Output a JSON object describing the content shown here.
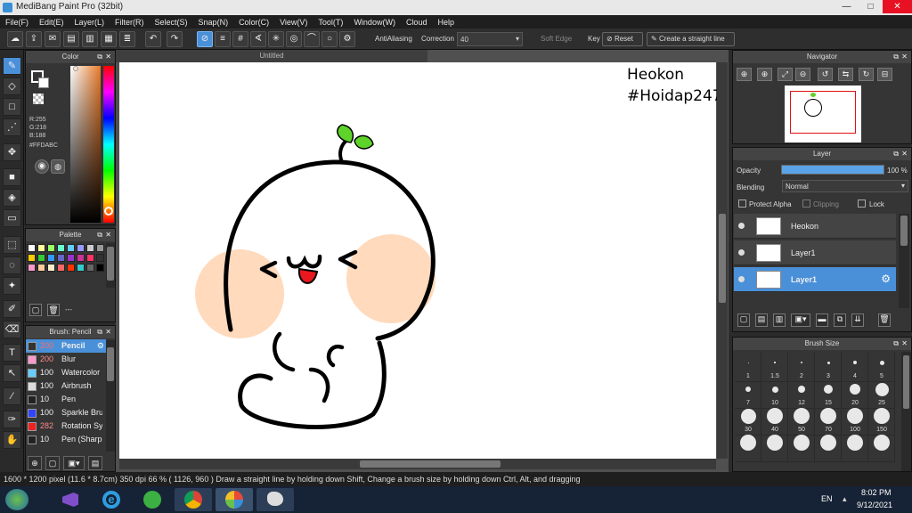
{
  "window": {
    "title": "MediBang Paint Pro (32bit)",
    "min": "—",
    "max": "□",
    "close": "✕"
  },
  "menu": [
    "File(F)",
    "Edit(E)",
    "Layer(L)",
    "Filter(R)",
    "Select(S)",
    "Snap(N)",
    "Color(C)",
    "View(V)",
    "Tool(T)",
    "Window(W)",
    "Cloud",
    "Help"
  ],
  "toolbar": {
    "antialiasing_label": "AntiAliasing",
    "correction_label": "Correction",
    "correction_value": "40",
    "soft_edge_label": "Soft Edge",
    "key_label": "Key",
    "reset_label": "Reset",
    "straight_line_label": "Create a straight line"
  },
  "color_panel": {
    "title": "Color",
    "rgb": [
      "R:255",
      "G:218",
      "B:188"
    ],
    "hex": "#FFDABC",
    "main_color": "#e8362a",
    "secondary_color": "#ffffff"
  },
  "palette_panel": {
    "title": "Palette",
    "more_label": "---",
    "swatches": [
      "#ffffff",
      "#ffff99",
      "#99ff66",
      "#66ffcc",
      "#66ccff",
      "#9999ff",
      "#cccccc",
      "#999999",
      "#ffcc00",
      "#33cc33",
      "#3399ff",
      "#6666cc",
      "#9933cc",
      "#cc3399",
      "#ff3366",
      "#333333",
      "#ff99cc",
      "#ffcc99",
      "#ffeecc",
      "#ff6666",
      "#ff3300",
      "#33cccc",
      "#666666",
      "#000000"
    ]
  },
  "brush_panel": {
    "title": "Brush: Pencil",
    "brushes": [
      {
        "size": "200",
        "name": "Pencil",
        "color": "#333333",
        "selected": true
      },
      {
        "size": "200",
        "name": "Blur",
        "color": "#ff99cc",
        "selected": false
      },
      {
        "size": "100",
        "name": "Watercolor",
        "color": "#66ccff",
        "selected": false
      },
      {
        "size": "100",
        "name": "Airbrush",
        "color": "#dddddd",
        "selected": false
      },
      {
        "size": "10",
        "name": "Pen",
        "color": "#222222",
        "selected": false
      },
      {
        "size": "100",
        "name": "Sparkle Bru",
        "color": "#3344ff",
        "selected": false
      },
      {
        "size": "282",
        "name": "Rotation Sy",
        "color": "#ee2222",
        "selected": false
      },
      {
        "size": "10",
        "name": "Pen (Sharp",
        "color": "#222222",
        "selected": false
      }
    ]
  },
  "document": {
    "tab_title": "Untitled"
  },
  "canvas_text": {
    "line1": "Heokon",
    "line2": "#Hoidap247"
  },
  "navigator": {
    "title": "Navigator"
  },
  "layer_panel": {
    "title": "Layer",
    "opacity_label": "Opacity",
    "opacity_value": "100 %",
    "opacity_fraction": 1.0,
    "blending_label": "Blending",
    "blending_value": "Normal",
    "protect_alpha_label": "Protect Alpha",
    "clipping_label": "Clipping",
    "lock_label": "Lock",
    "layers": [
      {
        "name": "Heokon",
        "selected": false
      },
      {
        "name": "Layer1",
        "selected": false
      },
      {
        "name": "Layer1",
        "selected": true
      }
    ]
  },
  "brush_size_panel": {
    "title": "Brush Size",
    "sizes": [
      "1",
      "1.5",
      "2",
      "3",
      "4",
      "5",
      "7",
      "10",
      "12",
      "15",
      "20",
      "25",
      "30",
      "40",
      "50",
      "70",
      "100",
      "150"
    ]
  },
  "status": "1600 * 1200 pixel   (11.6 * 8.7cm)   350 dpi   66 %   ( 1126, 960 )   Draw a straight line by holding down Shift, Change a brush size by holding down Ctrl, Alt, and dragging",
  "taskbar": {
    "lang": "EN",
    "time": "8:02 PM",
    "date": "9/12/2021"
  }
}
